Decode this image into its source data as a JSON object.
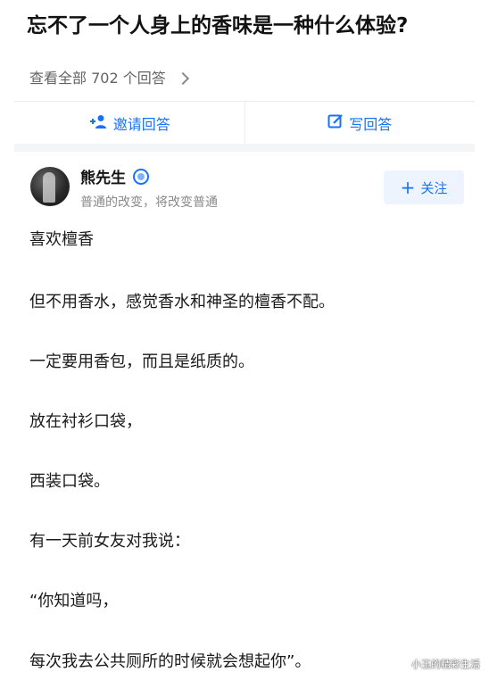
{
  "question": {
    "title": "忘不了一个人身上的香味是一种什么体验?",
    "view_all_label": "查看全部 702 个回答"
  },
  "actions": {
    "invite_label": "邀请回答",
    "write_label": "写回答",
    "accent_color": "#1772f6"
  },
  "author": {
    "name": "熊先生",
    "bio": "普通的改变，将改变普通",
    "follow_label": "关注"
  },
  "answer": {
    "paragraphs": [
      "喜欢檀香",
      "但不用香水，感觉香水和神圣的檀香不配。",
      "一定要用香包，而且是纸质的。",
      "放在衬衫口袋，",
      "西装口袋。",
      "有一天前女友对我说：",
      "“你知道吗，",
      "每次我去公共厕所的时候就会想起你”。"
    ]
  },
  "watermark": "小玉的精彩生活"
}
